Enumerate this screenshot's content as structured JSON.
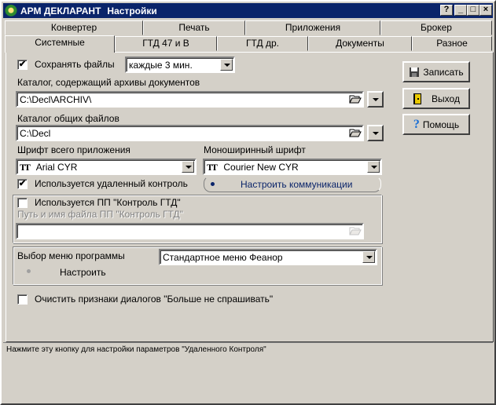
{
  "window": {
    "app_name": "АРМ ДЕКЛАРАНТ",
    "dialog_title": "Настройки",
    "help_btn": "?",
    "min_btn": "_",
    "max_btn": "□",
    "close_btn": "×"
  },
  "tabs_top": [
    "Конвертер",
    "Печать",
    "Приложения",
    "Брокер"
  ],
  "tabs_bottom": [
    "Системные",
    "ГТД 47 и В",
    "ГТД др.",
    "Документы",
    "Разное"
  ],
  "form": {
    "save_files_label": "Сохранять файлы",
    "save_files_checked": "✔",
    "save_interval_value": "каждые 3 мин.",
    "archive_dir_label": "Каталог, содержащий архивы документов",
    "archive_dir_value": "C:\\Decl\\ARCHIV\\",
    "common_dir_label": "Каталог общих файлов",
    "common_dir_value": "C:\\Decl",
    "app_font_label": "Шрифт всего приложения",
    "app_font_value": "Arial CYR",
    "mono_font_label": "Моноширинный шрифт",
    "mono_font_value": "Courier New CYR",
    "font_icon": "TT",
    "remote_control_label": "Используется удаленный контроль",
    "remote_control_checked": "✔",
    "setup_comm_label": "Настроить коммуникации",
    "pp_control_label": "Используется ПП \"Контроль ГТД\"",
    "pp_path_label": "Путь и имя файла ПП \"Контроль ГТД\"",
    "pp_path_value": "",
    "menu_choice_label": "Выбор меню программы",
    "menu_choice_value": "Стандартное меню Феанор",
    "configure_label": "Настроить",
    "clear_dialogs_label": "Очистить признаки диалогов \"Больше не спрашивать\""
  },
  "buttons": {
    "save": "Записать",
    "exit": "Выход",
    "help": "Помощь"
  },
  "status_text": "Нажмите эту кнопку для настройки параметров \"Удаленного Контроля\"",
  "colors": {
    "titlebar": "#0a246a",
    "face": "#d4d0c8",
    "link_blue": "#0a246a",
    "help_icon": "#1a6fd6",
    "exit_icon": "#e8c800"
  },
  "icons": {
    "app": "app-emblem-icon",
    "folder_browse": "folder-open-icon",
    "save": "floppy-disk-icon",
    "exit": "exit-door-icon",
    "help": "question-mark-icon"
  }
}
